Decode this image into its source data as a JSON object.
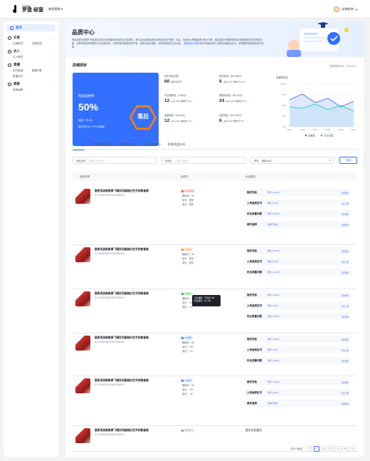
{
  "topbar": {
    "logo_small": "抖音电商",
    "logo_big": "罗盘 经营",
    "shop_selector": "商家视角",
    "user_name": "店铺名称"
  },
  "sidebar": {
    "home": "首页",
    "groups": [
      {
        "title": "交易",
        "icon": "transaction-icon",
        "items": [
          "交易概况",
          "交易构成"
        ]
      },
      {
        "title": "达人",
        "icon": "creator-icon",
        "items": [
          "达人概览"
        ]
      },
      {
        "title": "直播",
        "icon": "live-icon",
        "items": [
          "实时直播",
          "直播列表",
          "直播分析"
        ]
      },
      {
        "title": "商家",
        "icon": "merchant-icon",
        "items": [
          "商家画像"
        ]
      }
    ]
  },
  "hero": {
    "title": "品质中心",
    "desc_main": "商品品质分是基于商品综合质量与消费者体验的综合评估体系，我们会对店铺近期售出商品的用户退货、售后、负面评价等维度进行统计分析，通过品质分帮助商家及时发现商品存在的风险问题。优质商品将获得更多平台流量扶持，劣质商品将被限流或下架。品质分每日更新，请商家持续关注并优化。",
    "link_text": "查看品质分规则",
    "desc_tail": "提升商品品质可以提高店铺综合评分，获得更多消费者信任与复购。"
  },
  "status": {
    "title": "店铺现状",
    "update": "数据更新时间：2022/4/12",
    "card": {
      "label": "商品及格率",
      "value": "50%",
      "sub1": "较前一日 3%",
      "sub2": "超过同行业 70% 的商家",
      "grade": "落后"
    },
    "metrics": [
      {
        "title": "在售商品总数",
        "value": "60",
        "sub": "较昨日持平",
        "dir": ""
      },
      {
        "title": "不合格商品（0-59分）",
        "value": "12",
        "sub": "占比 20%  较昨日 3%",
        "dir": "up"
      },
      {
        "title": "及格商品（60-84分）",
        "value": "12",
        "sub": "占比 20%  较昨日 3%",
        "dir": "up"
      },
      {
        "title": "良好商品（85-100分）",
        "value": "6",
        "sub": "占比 10%  较昨日 12%",
        "dir": "dn"
      },
      {
        "title": "需整改商品（60-74分）",
        "value": "24",
        "sub": "占比 40%  较昨日 3%",
        "dir": "up"
      },
      {
        "title": "优质商品（85-100分）",
        "value": "6",
        "sub": "占比 10%  较昨日 3%",
        "dir": "up"
      }
    ],
    "trend_title": "及格率变化",
    "trend_dates": [
      "04/01",
      "04/02",
      "04/03",
      "04/04",
      "04/05",
      "04/06"
    ],
    "trend_yticks": [
      "100%",
      "75%",
      "50%",
      "25%",
      "0%"
    ],
    "trend_legend": [
      "及格率",
      "行业均值"
    ]
  },
  "tabs": [
    "全部商品",
    "不及格商品(12)",
    "及格商品(6)",
    "良好商品(30)",
    "优质商品(30)"
  ],
  "filters": {
    "name_label": "商品名称",
    "name_ph": "请输入商品名称",
    "id_label": "商品ID",
    "id_ph": "请输入商品ID",
    "sort_label": "排序",
    "sort_value": "销量top10",
    "query": "查询"
  },
  "table": {
    "headers": [
      "商品名称",
      "品质分",
      "优化建议"
    ],
    "rows": [
      {
        "name": "厨房用具新款厚飞锅实用套装红色节庆款套装",
        "id": "ID:12982298229822980000",
        "badge": "40不及格",
        "badge_color": "red",
        "scores": [
          "基础分：40",
          "加分：暂无",
          "减分：暂无"
        ],
        "sugs": [
          {
            "title": "做好货品",
            "tag": "预计+0-20分",
            "action": "去优化"
          },
          {
            "title": "上传品质证书",
            "tag": "预计+0-6分",
            "action": "去上传"
          },
          {
            "title": "优化质量问题",
            "tag": "预计+0-20分",
            "action": "去分析"
          },
          {
            "title": "填写品牌",
            "tag": "有助于提分",
            "action": "去填写"
          }
        ]
      },
      {
        "name": "厨房用具新款厚飞锅实用套装红色节庆款套装",
        "id": "ID:12982298229822980000",
        "badge": "60及格",
        "badge_color": "orange",
        "scores": [
          "基础分：40",
          "加分：暂无",
          "减分：暂无"
        ],
        "sugs": [
          {
            "title": "做好货品",
            "tag": "预计+0-20分",
            "action": "去优化"
          },
          {
            "title": "上传品质证书",
            "tag": "预计+0-6分",
            "action": "去上传"
          },
          {
            "title": "优化质量问题",
            "tag": "预计+0-20分",
            "action": "去分析"
          }
        ]
      },
      {
        "name": "厨房用具新款厚飞锅实用套装红色节庆款套装",
        "id": "ID:12982298229822980000",
        "badge": "80良好",
        "badge_color": "green",
        "scores": [
          "基础分：40",
          "加分：+10",
          "减分：-10"
        ],
        "tooltip": [
          "平台保障：不合格 -5分",
          "售后服务：12 -5分"
        ],
        "sugs": [
          {
            "title": "做好货品",
            "tag": "预计+0-20分",
            "action": "去优化"
          },
          {
            "title": "上传品质证书",
            "tag": "预计+0-6分",
            "action": "去上传"
          },
          {
            "title": "优化质量问题",
            "tag": "预计+0-20分",
            "action": "去分析"
          }
        ]
      },
      {
        "name": "厨房用具新款厚飞锅实用套装红色节庆款套装",
        "id": "ID:12982298229822980000",
        "badge": "70优秀",
        "badge_color": "blue",
        "scores": [
          "基础分：50",
          "加分：+30",
          "减分：-10"
        ],
        "sugs": [
          {
            "title": "做好货品",
            "tag": "预计+0-20分",
            "action": "去优化"
          },
          {
            "title": "上传品质证书",
            "tag": "预计+0-6分",
            "action": "去上传"
          },
          {
            "title": "优化质量问题",
            "tag": "预计+0-20分",
            "action": "去分析"
          }
        ]
      },
      {
        "name": "厨房用具新款厚飞锅实用套装红色节庆款套装",
        "id": "ID:12982298229822980000",
        "badge": "70优秀",
        "badge_color": "blue",
        "scores": [
          "基础分：50",
          "加分：+30",
          "减分：-10"
        ],
        "sugs": [
          {
            "title": "做好货品",
            "tag": "预计+0-20分",
            "action": "去优化"
          },
          {
            "title": "上传品质证书",
            "tag": "预计+0-6分",
            "action": "去上传"
          },
          {
            "title": "填写品牌",
            "tag": "有助于提分",
            "action": "去填写"
          }
        ]
      },
      {
        "name": "厨房用具新款厚飞锅实用套装红色节庆款套装",
        "id": "ID:12982298229822980000",
        "badge": "暂无评分",
        "badge_color": "gray",
        "scores": [],
        "plain_sug": "暂无优化建议",
        "sugs": []
      }
    ]
  },
  "pager": {
    "total": "共5个商品",
    "prev": "<",
    "pages": [
      "1",
      "2",
      "3",
      "4",
      "5"
    ],
    "next": ">"
  },
  "colors": {
    "accent": "#3370ff",
    "warn": "#ff7d00",
    "good": "#00b42a",
    "bad": "#f53f3f"
  }
}
